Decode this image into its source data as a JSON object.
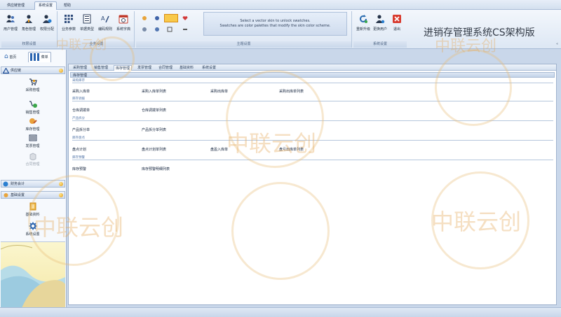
{
  "menu": {
    "tabs": [
      "供应链管理",
      "系统设置",
      "帮助"
    ]
  },
  "ribbon": {
    "group1": {
      "title": "权限设置",
      "buttons": [
        {
          "label": "用户管理",
          "icon": "users-icon"
        },
        {
          "label": "角色管理",
          "icon": "role-icon"
        },
        {
          "label": "权限分配",
          "icon": "permission-icon"
        }
      ]
    },
    "group2": {
      "title": "业务设置",
      "buttons": [
        {
          "label": "业务参数",
          "icon": "grid-icon"
        },
        {
          "label": "单据类型",
          "icon": "document-icon"
        },
        {
          "label": "编码规则",
          "icon": "code-rule-icon"
        },
        {
          "label": "系统字典",
          "icon": "calendar-icon"
        }
      ]
    },
    "theme": {
      "title": "主题设置",
      "line1": "Select a vector skin to unlock swatches.",
      "line2": "Swatches are color palettes that modify the skin color scheme."
    },
    "group4": {
      "title": "系统设置",
      "buttons": [
        {
          "label": "重新升级",
          "icon": "refresh-icon"
        },
        {
          "label": "更换用户",
          "icon": "switch-user-icon"
        },
        {
          "label": "退出",
          "icon": "exit-icon"
        }
      ]
    },
    "brand": "进销存管理系统CS架构版"
  },
  "nav": {
    "tabs": [
      {
        "label": "首页"
      },
      {
        "label": "菜单"
      }
    ],
    "header1": "供应链",
    "items": [
      {
        "label": "采购管理",
        "icon": "cart-icon"
      },
      {
        "label": "销售管理",
        "icon": "sales-icon"
      },
      {
        "label": "库存管理",
        "icon": "inventory-icon"
      },
      {
        "label": "发票管理",
        "icon": "invoice-icon"
      },
      {
        "label": "合同管理",
        "icon": "contract-icon"
      }
    ],
    "header2": "财务会计",
    "header3": "基础设置",
    "items2": [
      {
        "label": "基础资料",
        "icon": "base-data-icon"
      },
      {
        "label": "系统设置",
        "icon": "gear-icon"
      }
    ]
  },
  "main": {
    "subtabs": [
      "采购管理",
      "销售管理",
      "库存管理",
      "发票管理",
      "合同管理",
      "基础资料",
      "系统设置"
    ],
    "active_subtab": "库存管理",
    "panel_title": "库存管理",
    "sections": [
      {
        "title": "采购库存",
        "links": [
          "采购入库单",
          "采购入库单列表",
          "采购出库单",
          "采购出库单列表"
        ]
      },
      {
        "title": "库存调拨",
        "links": [
          "仓库调拨单",
          "仓库调拨单列表"
        ]
      },
      {
        "title": "产品拆分",
        "links": [
          "产品拆分单",
          "产品拆分单列表"
        ]
      },
      {
        "title": "库存盘点",
        "links": [
          "盘点计划",
          "盘点计划单列表",
          "盘盈入库单",
          "盘亏出库单列表"
        ]
      },
      {
        "title": "库存预警",
        "links": [
          "库存预警",
          "库存预警明细列表"
        ]
      }
    ]
  },
  "watermark": "中联云创"
}
